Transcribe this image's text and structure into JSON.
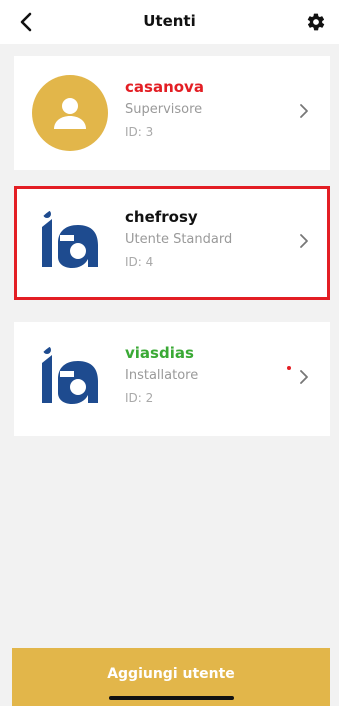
{
  "header": {
    "title": "Utenti",
    "back_icon": "chevron-left-icon",
    "settings_icon": "gear-icon"
  },
  "users": [
    {
      "name": "casanova",
      "name_color": "#e31e24",
      "role": "Supervisore",
      "id_label": "ID: 3",
      "avatar": "user-icon",
      "selected": false
    },
    {
      "name": "chefrosy",
      "name_color": "#111111",
      "role": "Utente Standard",
      "id_label": "ID: 4",
      "avatar": "ia-logo",
      "selected": true
    },
    {
      "name": "viasdias",
      "name_color": "#3aa935",
      "role": "Installatore",
      "id_label": "ID: 2",
      "avatar": "ia-logo",
      "selected": false
    }
  ],
  "footer": {
    "add_label": "Aggiungi utente"
  },
  "colors": {
    "accent": "#e2b64a",
    "selection_border": "#e31e24",
    "logo_blue": "#1e4b8f"
  }
}
